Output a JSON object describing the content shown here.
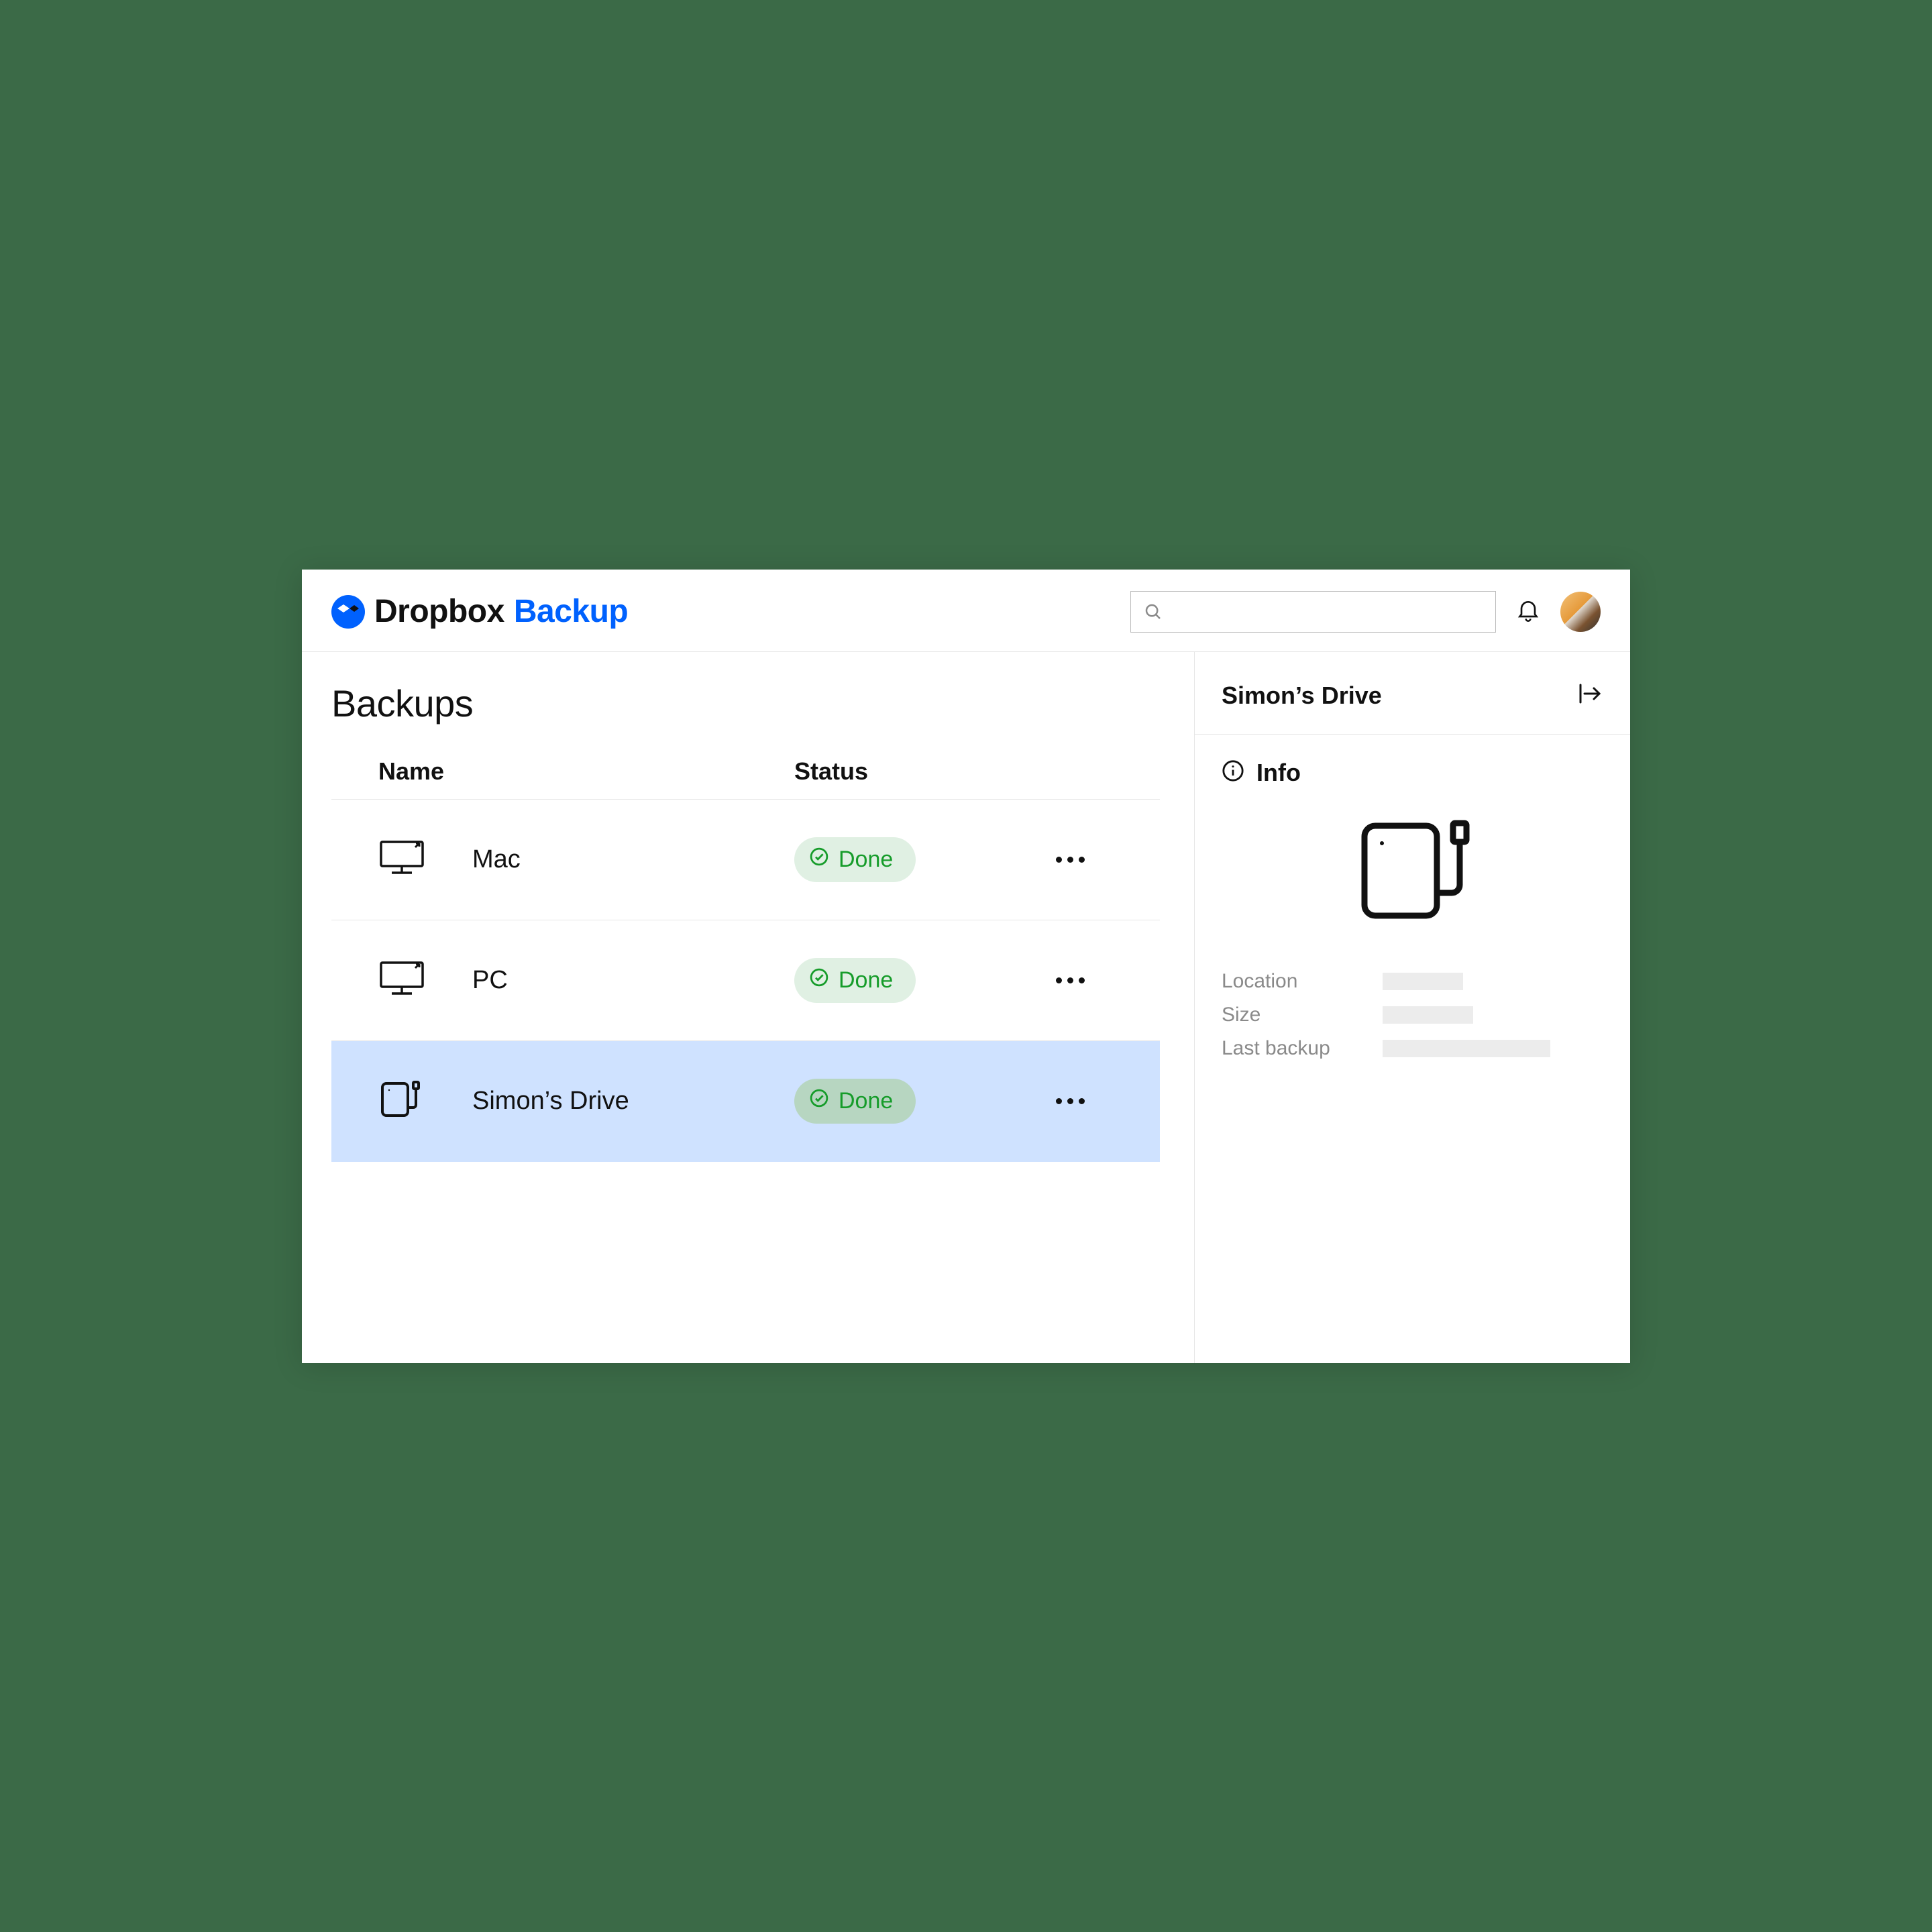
{
  "brand": {
    "name": "Dropbox",
    "product": "Backup"
  },
  "header": {
    "search_placeholder": ""
  },
  "page": {
    "title": "Backups"
  },
  "table": {
    "columns": {
      "name": "Name",
      "status": "Status"
    },
    "rows": [
      {
        "icon": "desktop-icon",
        "name": "Mac",
        "status": "Done",
        "selected": false
      },
      {
        "icon": "desktop-icon",
        "name": "PC",
        "status": "Done",
        "selected": false
      },
      {
        "icon": "external-drive-icon",
        "name": "Simon’s Drive",
        "status": "Done",
        "selected": true
      }
    ]
  },
  "sidepanel": {
    "title": "Simon’s Drive",
    "info_label": "Info",
    "meta_labels": {
      "location": "Location",
      "size": "Size",
      "last_backup": "Last backup"
    }
  },
  "colors": {
    "accent": "#0061fe",
    "status_done": "#169c2a"
  }
}
